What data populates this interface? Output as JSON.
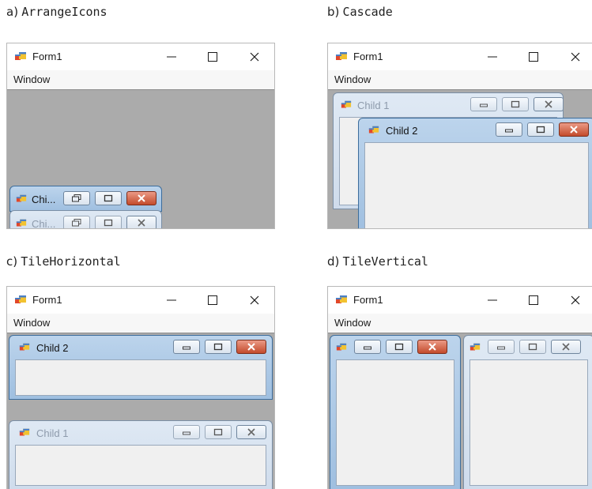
{
  "captions": {
    "a": {
      "letter": "a)",
      "name": "ArrangeIcons"
    },
    "b": {
      "letter": "b)",
      "name": "Cascade"
    },
    "c": {
      "letter": "c)",
      "name": "TileHorizontal"
    },
    "d": {
      "letter": "d)",
      "name": "TileVertical"
    }
  },
  "form": {
    "title": "Form1",
    "menu": "Window",
    "minimize_glyph": "—",
    "close_glyph": "✕"
  },
  "panel_a": {
    "icons": [
      {
        "title": "Chi...",
        "state": "active"
      },
      {
        "title": "Chi...",
        "state": "inactive"
      }
    ]
  },
  "panel_b": {
    "children": [
      {
        "title": "Child 1",
        "state": "inactive"
      },
      {
        "title": "Child 2",
        "state": "active"
      }
    ]
  },
  "panel_c": {
    "children": [
      {
        "title": "Child 2",
        "state": "active"
      },
      {
        "title": "Child 1",
        "state": "inactive"
      }
    ]
  },
  "panel_d": {
    "children": [
      {
        "title": "",
        "state": "active"
      },
      {
        "title": "",
        "state": "inactive"
      }
    ]
  },
  "colors": {
    "mdi_background": "#ababab",
    "active_caption": "#9fbfe0",
    "inactive_caption": "#cfdcec",
    "close_button": "#c34b2c"
  },
  "icons": [
    "app-icon",
    "minimize-icon",
    "maximize-icon",
    "close-icon",
    "restore-icon"
  ]
}
